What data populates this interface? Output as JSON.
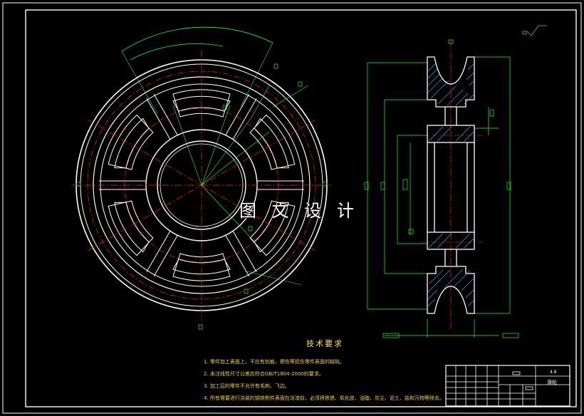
{
  "watermark": "图 文 设 计",
  "technical_requirements": {
    "title": "技术要求",
    "notes": [
      "1. 零件加工表面上，不应有划痕、擦伤等损伤零件表面的缺陷。",
      "2. 未注线性尺寸公差应符合GB/T1804-2000的要求。",
      "3. 加工后的零件不允许有毛刺、飞边。",
      "4. 所有需要进行涂装的钢铁制件表面在涂漆前，必须将铁锈、氧化皮、油脂、灰尘、泥土、盐和污物等除去。"
    ]
  },
  "title_block": {
    "name": "滑轮",
    "code": "4.8"
  },
  "colors": {
    "background": "#000000",
    "outline": "#ffffff",
    "centerline": "#ff2020",
    "dimension": "#20ff20",
    "hatch": "#20c0ff",
    "text": "#f0d040"
  }
}
